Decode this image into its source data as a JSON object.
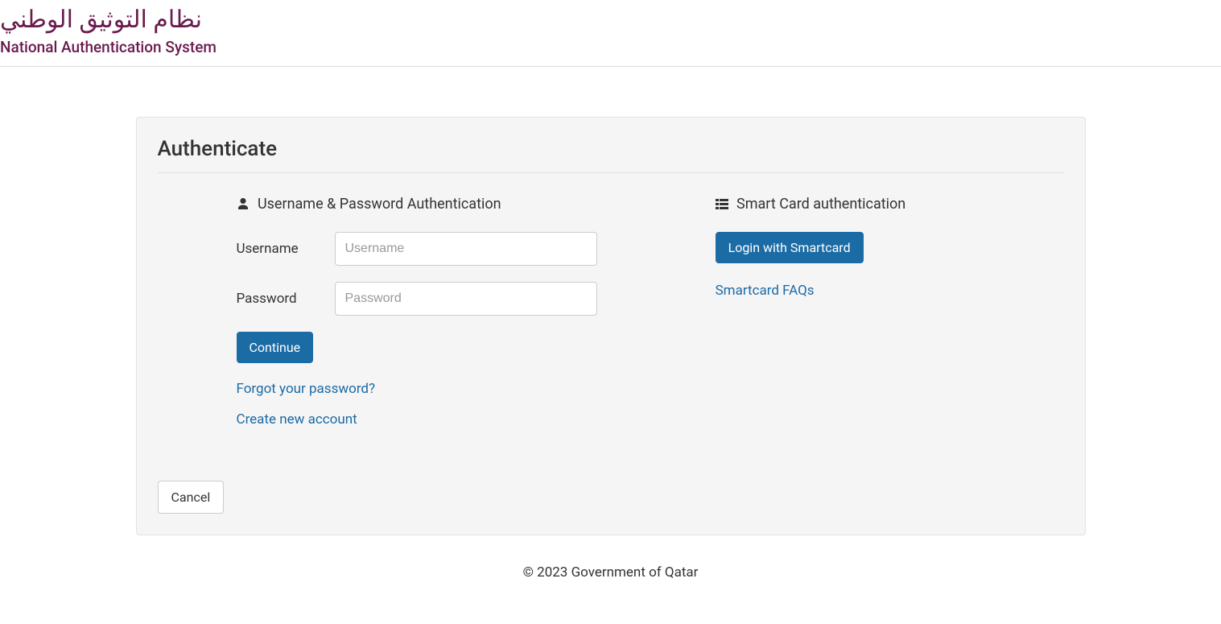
{
  "header": {
    "logo_ar": "نظام التوثيق الوطني",
    "logo_en": "National Authentication System"
  },
  "panel": {
    "title": "Authenticate"
  },
  "userpass": {
    "section_title": "Username & Password Authentication",
    "username_label": "Username",
    "username_placeholder": "Username",
    "password_label": "Password",
    "password_placeholder": "Password",
    "continue_label": "Continue",
    "forgot_link": "Forgot your password?",
    "create_link": "Create new account"
  },
  "smartcard": {
    "section_title": "Smart Card authentication",
    "login_button": "Login with Smartcard",
    "faq_link": "Smartcard FAQs"
  },
  "cancel_label": "Cancel",
  "footer": {
    "copyright": "© 2023 Government of Qatar"
  }
}
